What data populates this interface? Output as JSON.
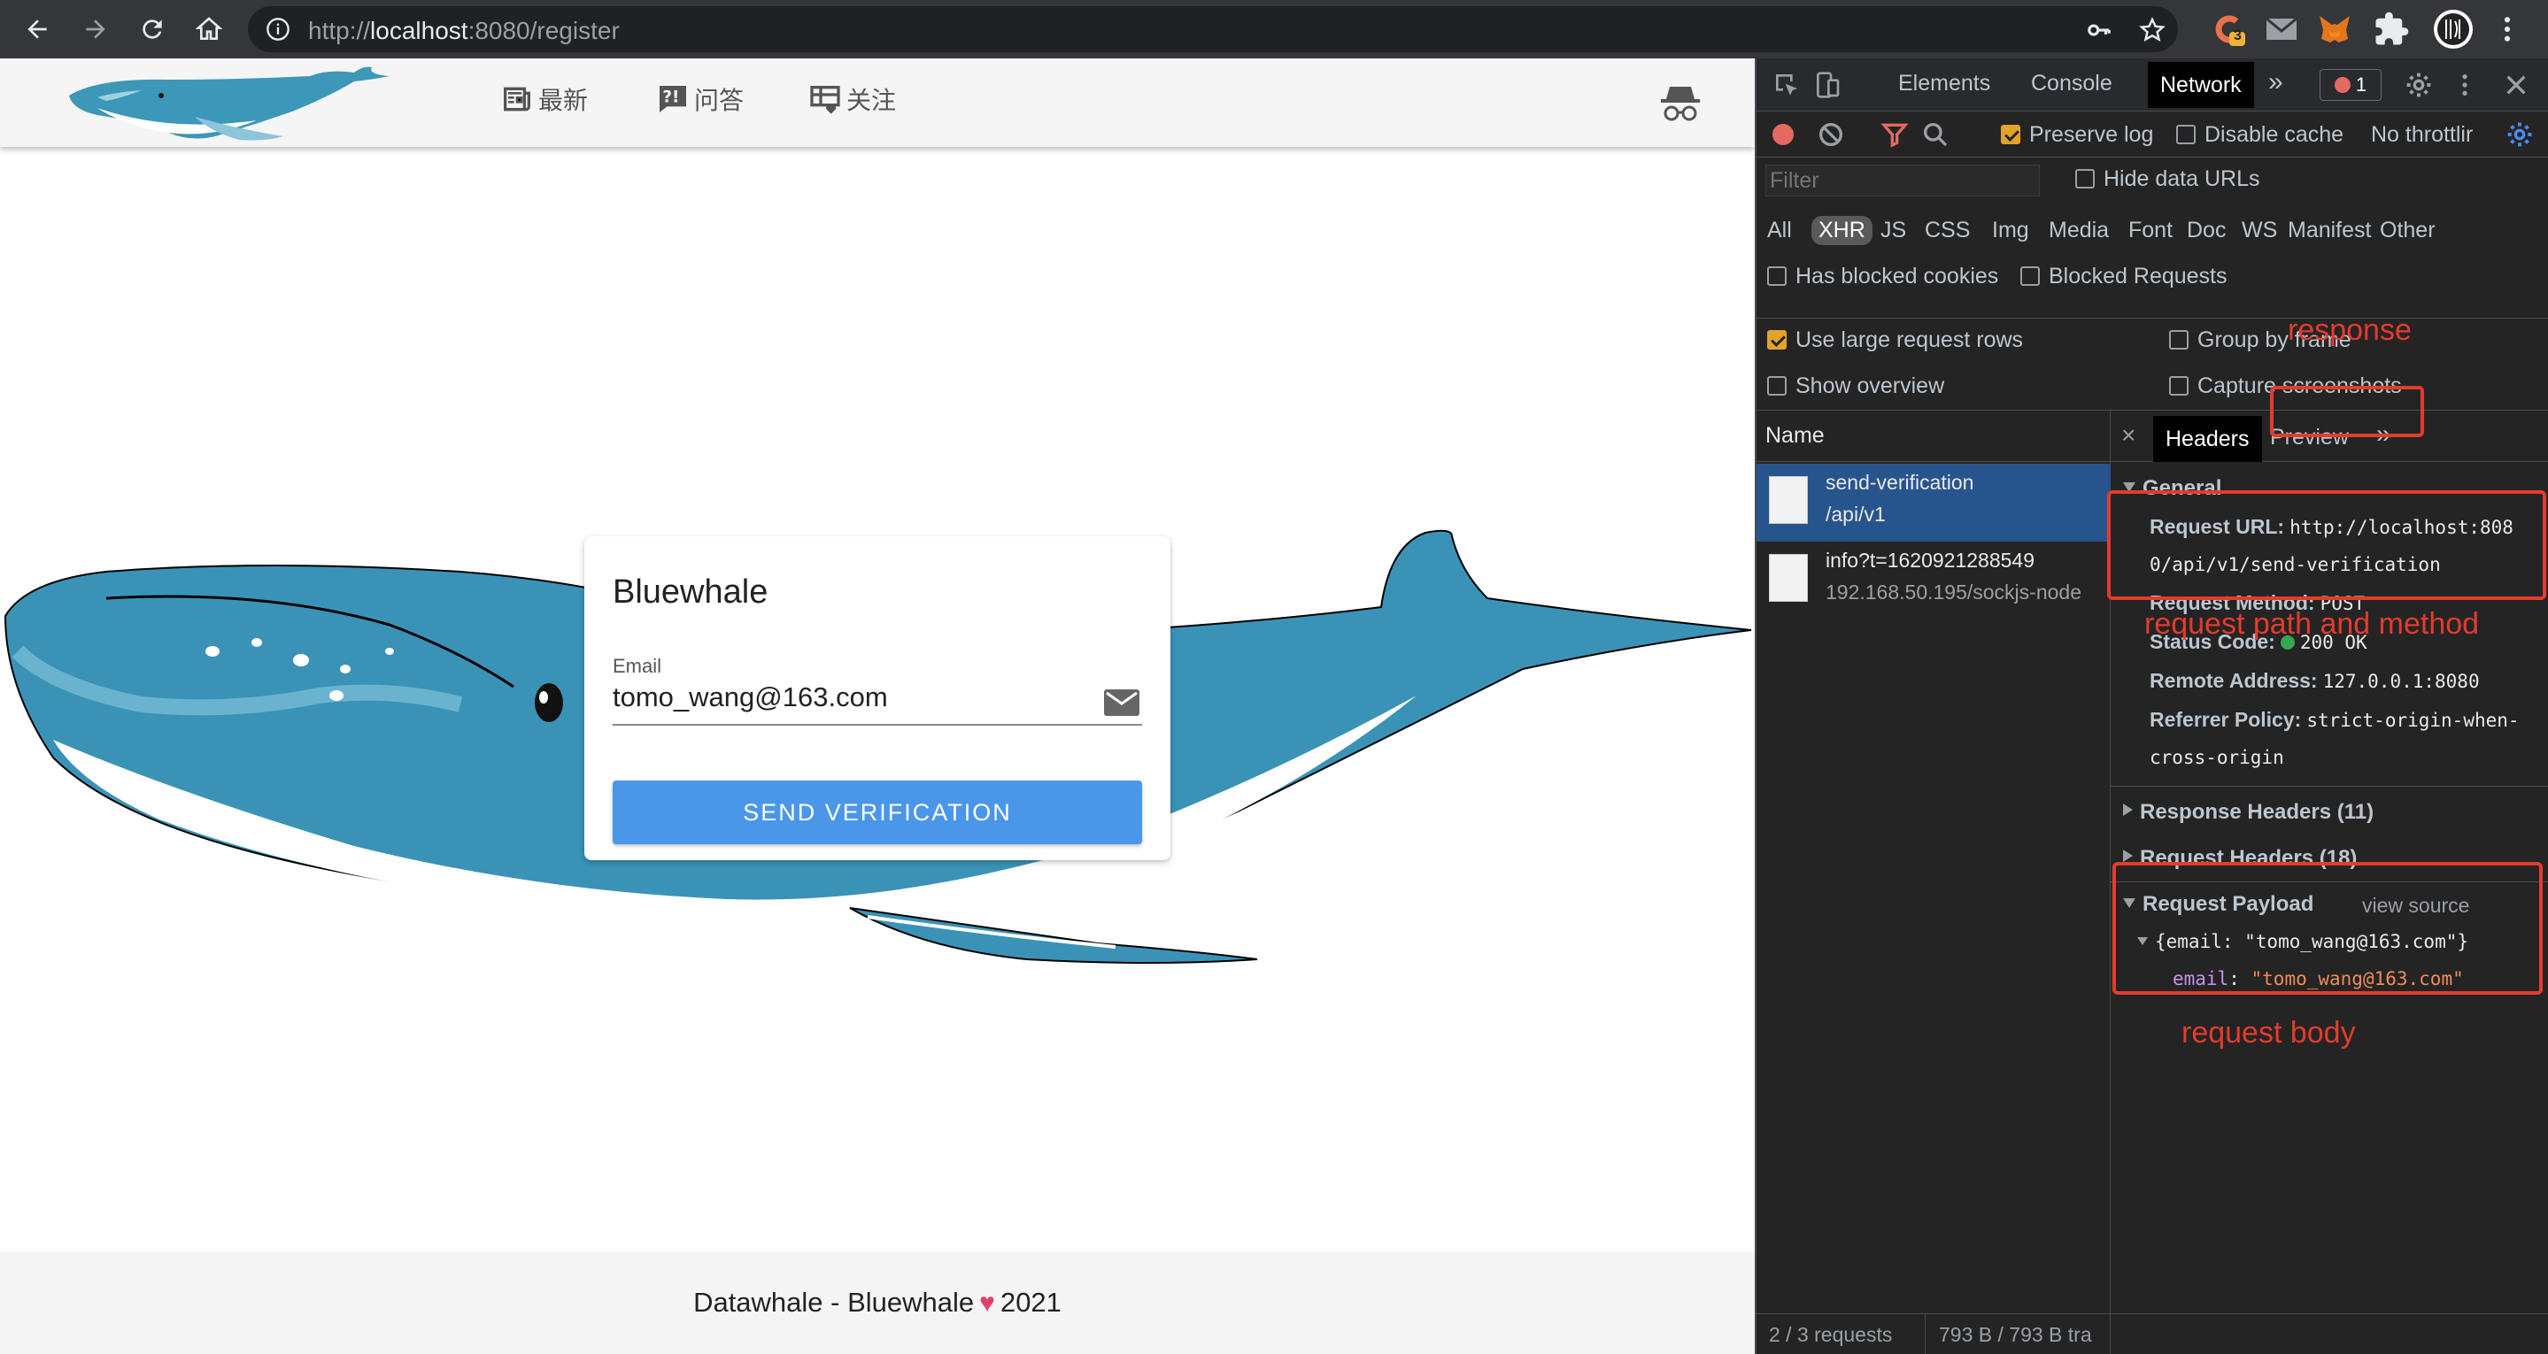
{
  "browser": {
    "url_scheme": "http://",
    "url_host": "localhost",
    "url_rest": ":8080/register",
    "extension_badge": "3"
  },
  "site": {
    "nav": [
      {
        "label": "最新",
        "icon": "newspaper-icon"
      },
      {
        "label": "问答",
        "icon": "question-chat-icon"
      },
      {
        "label": "关注",
        "icon": "follow-icon"
      }
    ],
    "card": {
      "title": "Bluewhale",
      "email_label": "Email",
      "email_value": "tomo_wang@163.com",
      "button_label": "SEND VERIFICATION"
    },
    "footer": {
      "left": "Datawhale - Bluewhale",
      "heart": "♥",
      "right": "2021"
    }
  },
  "devtools": {
    "tabs": [
      "Elements",
      "Console",
      "Network"
    ],
    "active_tab": "Network",
    "more_tabs": "»",
    "error_count": "1",
    "toolbar": {
      "preserve_log": "Preserve log",
      "disable_cache": "Disable cache",
      "throttling": "No throttlir"
    },
    "filter": {
      "placeholder": "Filter",
      "hide_data_urls": "Hide data URLs",
      "types": [
        "All",
        "XHR",
        "JS",
        "CSS",
        "Img",
        "Media",
        "Font",
        "Doc",
        "WS",
        "Manifest",
        "Other"
      ],
      "active_type": "XHR",
      "has_blocked_cookies": "Has blocked cookies",
      "blocked_requests": "Blocked Requests"
    },
    "settings": {
      "large_rows": "Use large request rows",
      "group_by_frame": "Group by frame",
      "show_overview": "Show overview",
      "capture_screenshots": "Capture screenshots"
    },
    "list": {
      "header": "Name",
      "requests": [
        {
          "name": "send-verification",
          "path": "/api/v1"
        },
        {
          "name": "info?t=1620921288549",
          "path": "192.168.50.195/sockjs-node"
        }
      ]
    },
    "status_bar": {
      "requests": "2 / 3 requests",
      "transferred": "793 B / 793 B tra"
    },
    "detail": {
      "close": "×",
      "tabs": [
        "Headers",
        "Preview"
      ],
      "more": "»",
      "general_title": "General",
      "request_url_key": "Request URL:",
      "request_url_line1": "http://localhost:808",
      "request_url_line2": "0/api/v1/send-verification",
      "request_method_key": "Request Method:",
      "request_method_val": "POST",
      "status_code_key": "Status Code:",
      "status_code_val": "200 OK",
      "remote_address_key": "Remote Address:",
      "remote_address_val": "127.0.0.1:8080",
      "referrer_policy_key": "Referrer Policy:",
      "referrer_policy_line1": "strict-origin-when-",
      "referrer_policy_line2": "cross-origin",
      "response_headers": "Response Headers (11)",
      "request_headers": "Request Headers (18)",
      "request_payload": "Request Payload",
      "view_source": "view source",
      "payload_summary": "{email: \"tomo_wang@163.com\"}",
      "payload_key": "email",
      "payload_val": "\"tomo_wang@163.com\""
    },
    "annotations": {
      "response": "response",
      "request_path_method": "request path and method",
      "request_body": "request body"
    }
  },
  "colors": {
    "annotation_red": "#e53b2c",
    "button_blue": "#4a97ea",
    "whale_blue": "#3d97b8",
    "devtools_bg": "#242424",
    "selected_row": "#28548d"
  }
}
